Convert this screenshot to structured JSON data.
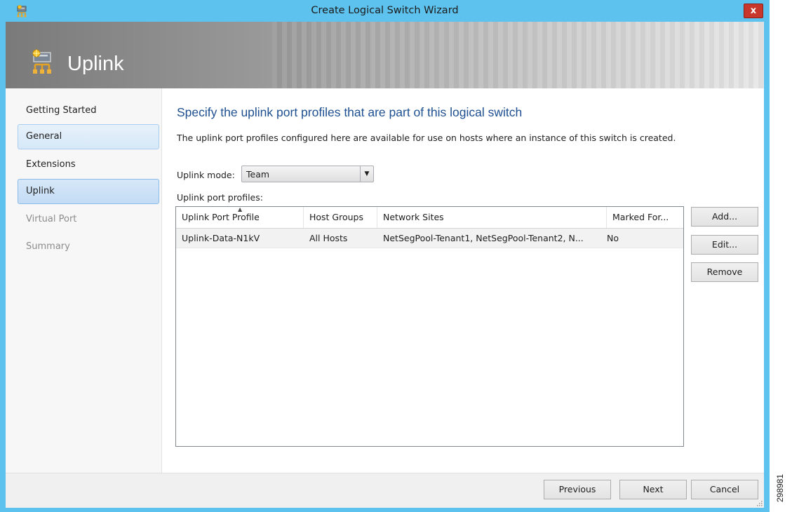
{
  "window": {
    "title": "Create Logical Switch Wizard",
    "close_glyph": "x",
    "icon": "logical-switch-icon"
  },
  "banner": {
    "heading": "Uplink",
    "icon": "uplink-icon"
  },
  "nav": {
    "items": [
      {
        "label": "Getting Started",
        "state": "normal"
      },
      {
        "label": "General",
        "state": "selected"
      },
      {
        "label": "Extensions",
        "state": "normal"
      },
      {
        "label": "Uplink",
        "state": "current"
      },
      {
        "label": "Virtual Port",
        "state": "disabled"
      },
      {
        "label": "Summary",
        "state": "disabled"
      }
    ]
  },
  "main": {
    "heading": "Specify the uplink port profiles that are part of this logical switch",
    "description": "The uplink port profiles configured here are available for use on hosts where an instance of this switch is created.",
    "mode_label": "Uplink mode:",
    "mode_value": "Team",
    "profiles_label": "Uplink port profiles:",
    "table": {
      "columns": [
        "Uplink Port Profile",
        "Host Groups",
        "Network Sites",
        "Marked For..."
      ],
      "sorted_column": "Uplink Port Profile",
      "rows": [
        [
          "Uplink-Data-N1kV",
          "All Hosts",
          "NetSegPool-Tenant1, NetSegPool-Tenant2, N...",
          "No"
        ]
      ]
    },
    "buttons": {
      "add": "Add...",
      "edit": "Edit...",
      "remove": "Remove"
    }
  },
  "footer": {
    "previous": "Previous",
    "next": "Next",
    "cancel": "Cancel"
  },
  "figure_id": "298981",
  "colors": {
    "titlebar": "#5ec2ee",
    "heading": "#1d4f91",
    "nav_selected": "#d6e8f8",
    "close": "#c7372b"
  }
}
